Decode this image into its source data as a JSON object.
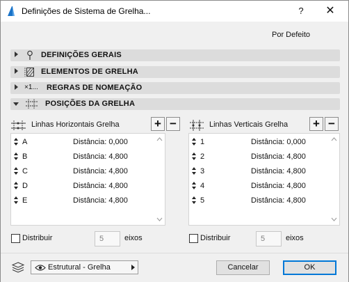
{
  "window": {
    "title": "Definições de Sistema de Grelha...",
    "help_glyph": "?",
    "close_glyph": "✕"
  },
  "header": {
    "default_label": "Por Defeito"
  },
  "sections": [
    {
      "label": "DEFINIÇÕES GERAIS",
      "icon": "pin-icon",
      "expanded": false
    },
    {
      "label": "ELEMENTOS DE GRELHA",
      "icon": "grid-element-icon",
      "expanded": false
    },
    {
      "label": "REGRAS DE NOMEAÇÃO",
      "icon": "naming-rule-icon",
      "icon_text": "×1...",
      "expanded": false
    },
    {
      "label": "POSIÇÕES DA GRELHA",
      "icon": "grid-positions-icon",
      "expanded": true
    }
  ],
  "horizontal": {
    "label": "Linhas Horizontais Grelha",
    "add": "+",
    "remove": "−",
    "rows": [
      {
        "name": "A",
        "distance": "Distância: 0,000"
      },
      {
        "name": "B",
        "distance": "Distância: 4,800"
      },
      {
        "name": "C",
        "distance": "Distância: 4,800"
      },
      {
        "name": "D",
        "distance": "Distância: 4,800"
      },
      {
        "name": "E",
        "distance": "Distância: 4,800"
      }
    ],
    "distribute_label": "Distribuir",
    "distribute_checked": false,
    "axes_value": "5",
    "axes_unit": "eixos"
  },
  "vertical": {
    "label": "Linhas Verticais Grelha",
    "add": "+",
    "remove": "−",
    "rows": [
      {
        "name": "1",
        "distance": "Distância: 0,000"
      },
      {
        "name": "2",
        "distance": "Distância: 4,800"
      },
      {
        "name": "3",
        "distance": "Distância: 4,800"
      },
      {
        "name": "4",
        "distance": "Distância: 4,800"
      },
      {
        "name": "5",
        "distance": "Distância: 4,800"
      }
    ],
    "distribute_label": "Distribuir",
    "distribute_checked": false,
    "axes_value": "5",
    "axes_unit": "eixos"
  },
  "footer": {
    "layer_value": "Estrutural - Grelha",
    "cancel_label": "Cancelar",
    "ok_label": "OK"
  },
  "colors": {
    "accent": "#0078d7",
    "section_bg": "#dcdcdc",
    "window_bg": "#f0f0f0",
    "app_icon": "#1a73c8"
  }
}
